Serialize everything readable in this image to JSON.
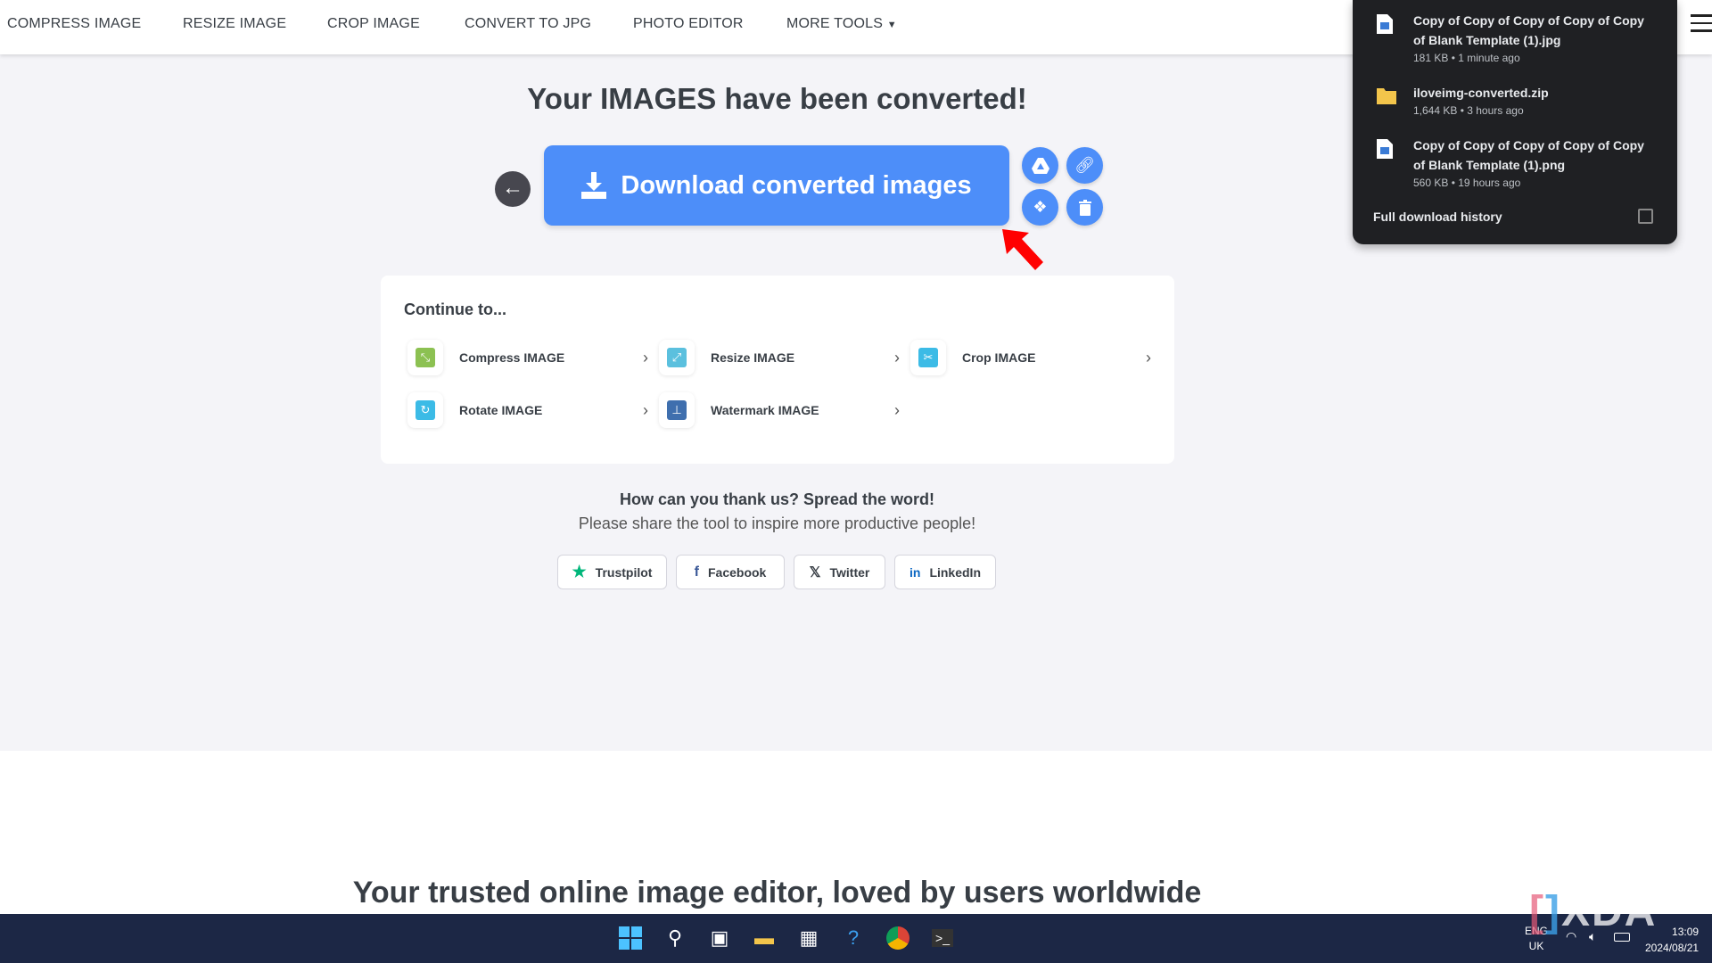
{
  "nav": {
    "items": [
      "COMPRESS IMAGE",
      "RESIZE IMAGE",
      "CROP IMAGE",
      "CONVERT TO JPG",
      "PHOTO EDITOR",
      "MORE TOOLS"
    ]
  },
  "main": {
    "title": "Your IMAGES have been converted!",
    "download_label": "Download converted images",
    "continue_title": "Continue to...",
    "continue_items": [
      {
        "label": "Compress IMAGE",
        "color": "#8cc152"
      },
      {
        "label": "Resize IMAGE",
        "color": "#5bc0de"
      },
      {
        "label": "Crop IMAGE",
        "color": "#3cbbe6"
      },
      {
        "label": "Rotate IMAGE",
        "color": "#3cbbe6"
      },
      {
        "label": "Watermark IMAGE",
        "color": "#3f6fae"
      }
    ],
    "thanks": "How can you thank us? Spread the word!",
    "thanks_sub": "Please share the tool to inspire more productive people!",
    "share": [
      "Trustpilot",
      "Facebook",
      "Twitter",
      "LinkedIn"
    ],
    "trusted": "Your trusted online image editor, loved by users worldwide",
    "accent": "#4d8ef9"
  },
  "downloads": {
    "items": [
      {
        "name": "Copy of Copy of Copy of Copy of Copy of Blank Template (1).jpg",
        "meta": "181 KB • 1 minute ago",
        "icon": "image-file-icon"
      },
      {
        "name": "iloveimg-converted.zip",
        "meta": "1,644 KB • 3 hours ago",
        "icon": "zip-folder-icon"
      },
      {
        "name": "Copy of Copy of Copy of Copy of Copy of Blank Template (1).png",
        "meta": "560 KB • 19 hours ago",
        "icon": "image-file-icon"
      }
    ],
    "history": "Full download history"
  },
  "tray": {
    "lang": "ENG",
    "region": "UK",
    "time": "13:09",
    "date": "2024/08/21"
  },
  "watermark": "XDA"
}
